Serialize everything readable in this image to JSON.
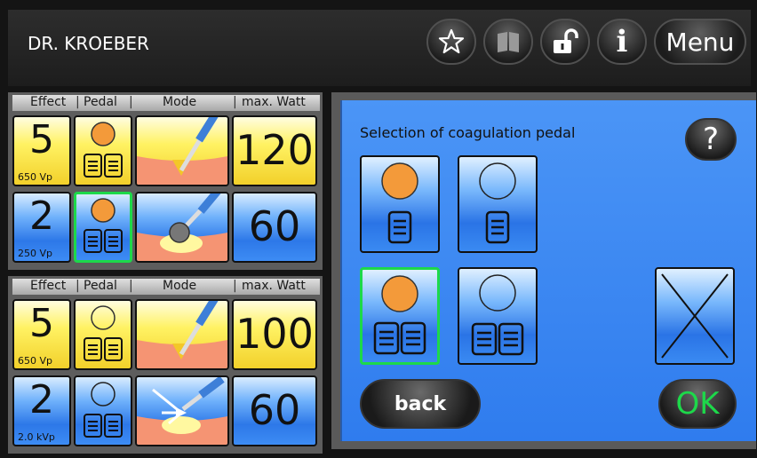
{
  "header": {
    "title": "DR. KROEBER",
    "menu_label": "Menu",
    "info_label": "i"
  },
  "channels": [
    {
      "columns": {
        "effect": "Effect",
        "pedal": "Pedal",
        "mode": "Mode",
        "max_watt": "max. Watt"
      },
      "rows": [
        {
          "effect": "5",
          "sub": "650 Vp",
          "watt": "120",
          "color": "yellow"
        },
        {
          "effect": "2",
          "sub": "250 Vp",
          "watt": "60",
          "color": "blue"
        }
      ]
    },
    {
      "columns": {
        "effect": "Effect",
        "pedal": "Pedal",
        "mode": "Mode",
        "max_watt": "max. Watt"
      },
      "rows": [
        {
          "effect": "5",
          "sub": "650 Vp",
          "watt": "100",
          "color": "yellow"
        },
        {
          "effect": "2",
          "sub": "2.0 kVp",
          "watt": "60",
          "color": "blue"
        }
      ]
    }
  ],
  "dialog": {
    "title": "Selection of coagulation pedal",
    "help_label": "?",
    "back_label": "back",
    "ok_label": "OK"
  },
  "colors": {
    "accent_green": "#1dd94a",
    "pedal_orange": "#f39a3a",
    "tile_yellow": "#fff263",
    "tile_blue": "#2d78e8"
  }
}
